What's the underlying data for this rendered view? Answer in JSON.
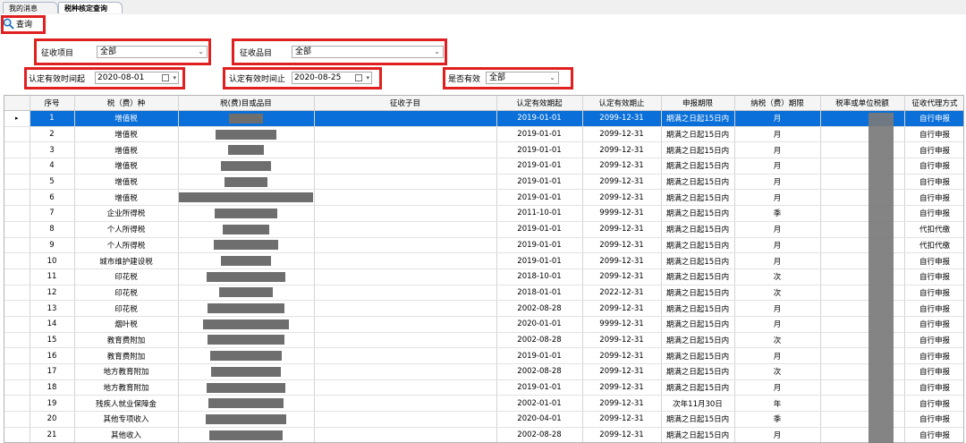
{
  "tabs": [
    {
      "label": "我的消息"
    },
    {
      "label": "税种核定查询",
      "active": true
    }
  ],
  "toolbar": {
    "query_label": "查询"
  },
  "filters": {
    "levy_item": {
      "label": "征收项目",
      "value": "全部"
    },
    "levy_category": {
      "label": "征收品目",
      "value": "全部"
    },
    "valid_start": {
      "label": "认定有效时间起",
      "value": "2020-08-01"
    },
    "valid_end": {
      "label": "认定有效时间止",
      "value": "2020-08-25"
    },
    "is_valid": {
      "label": "是否有效",
      "value": "全部"
    }
  },
  "colors": {
    "selected_row": "#0a6fd8",
    "highlight_box": "#e02020",
    "redaction": "#6e6e6e"
  },
  "grid": {
    "columns": [
      "",
      "序号",
      "税（费）种",
      "税(费)目或品目",
      "征收子目",
      "认定有效期起",
      "认定有效期止",
      "申报期限",
      "纳税（费）期限",
      "税率或单位税额",
      "征收代理方式"
    ],
    "rows": [
      {
        "no": "1",
        "tax": "增值税",
        "start": "2019-01-01",
        "end": "2099-12-31",
        "deadline": "期满之日起15日内",
        "period": "月",
        "method": "自行申报",
        "selected": true
      },
      {
        "no": "2",
        "tax": "增值税",
        "start": "2019-01-01",
        "end": "2099-12-31",
        "deadline": "期满之日起15日内",
        "period": "月",
        "method": "自行申报"
      },
      {
        "no": "3",
        "tax": "增值税",
        "start": "2019-01-01",
        "end": "2099-12-31",
        "deadline": "期满之日起15日内",
        "period": "月",
        "method": "自行申报"
      },
      {
        "no": "4",
        "tax": "增值税",
        "start": "2019-01-01",
        "end": "2099-12-31",
        "deadline": "期满之日起15日内",
        "period": "月",
        "method": "自行申报"
      },
      {
        "no": "5",
        "tax": "增值税",
        "start": "2019-01-01",
        "end": "2099-12-31",
        "deadline": "期满之日起15日内",
        "period": "月",
        "method": "自行申报"
      },
      {
        "no": "6",
        "tax": "增值税",
        "start": "2019-01-01",
        "end": "2099-12-31",
        "deadline": "期满之日起15日内",
        "period": "月",
        "method": "自行申报"
      },
      {
        "no": "7",
        "tax": "企业所得税",
        "start": "2011-10-01",
        "end": "9999-12-31",
        "deadline": "期满之日起15日内",
        "period": "季",
        "method": "自行申报"
      },
      {
        "no": "8",
        "tax": "个人所得税",
        "start": "2019-01-01",
        "end": "2099-12-31",
        "deadline": "期满之日起15日内",
        "period": "月",
        "method": "代扣代缴"
      },
      {
        "no": "9",
        "tax": "个人所得税",
        "start": "2019-01-01",
        "end": "2099-12-31",
        "deadline": "期满之日起15日内",
        "period": "月",
        "method": "代扣代缴"
      },
      {
        "no": "10",
        "tax": "城市维护建设税",
        "start": "2019-01-01",
        "end": "2099-12-31",
        "deadline": "期满之日起15日内",
        "period": "月",
        "method": "自行申报"
      },
      {
        "no": "11",
        "tax": "印花税",
        "start": "2018-10-01",
        "end": "2099-12-31",
        "deadline": "期满之日起15日内",
        "period": "次",
        "method": "自行申报"
      },
      {
        "no": "12",
        "tax": "印花税",
        "start": "2018-01-01",
        "end": "2022-12-31",
        "deadline": "期满之日起15日内",
        "period": "次",
        "method": "自行申报"
      },
      {
        "no": "13",
        "tax": "印花税",
        "start": "2002-08-28",
        "end": "2099-12-31",
        "deadline": "期满之日起15日内",
        "period": "月",
        "method": "自行申报"
      },
      {
        "no": "14",
        "tax": "烟叶税",
        "start": "2020-01-01",
        "end": "9999-12-31",
        "deadline": "期满之日起15日内",
        "period": "月",
        "method": "自行申报"
      },
      {
        "no": "15",
        "tax": "教育费附加",
        "start": "2002-08-28",
        "end": "2099-12-31",
        "deadline": "期满之日起15日内",
        "period": "次",
        "method": "自行申报"
      },
      {
        "no": "16",
        "tax": "教育费附加",
        "start": "2019-01-01",
        "end": "2099-12-31",
        "deadline": "期满之日起15日内",
        "period": "月",
        "method": "自行申报"
      },
      {
        "no": "17",
        "tax": "地方教育附加",
        "start": "2002-08-28",
        "end": "2099-12-31",
        "deadline": "期满之日起15日内",
        "period": "次",
        "method": "自行申报"
      },
      {
        "no": "18",
        "tax": "地方教育附加",
        "start": "2019-01-01",
        "end": "2099-12-31",
        "deadline": "期满之日起15日内",
        "period": "月",
        "method": "自行申报"
      },
      {
        "no": "19",
        "tax": "残疾人就业保障金",
        "start": "2002-01-01",
        "end": "2099-12-31",
        "deadline": "次年11月30日",
        "period": "年",
        "method": "自行申报"
      },
      {
        "no": "20",
        "tax": "其他专项收入",
        "start": "2020-04-01",
        "end": "2099-12-31",
        "deadline": "期满之日起15日内",
        "period": "季",
        "method": "自行申报"
      },
      {
        "no": "21",
        "tax": "其他收入",
        "start": "2002-08-28",
        "end": "2099-12-31",
        "deadline": "期满之日起15日内",
        "period": "月",
        "method": "自行申报"
      }
    ]
  }
}
